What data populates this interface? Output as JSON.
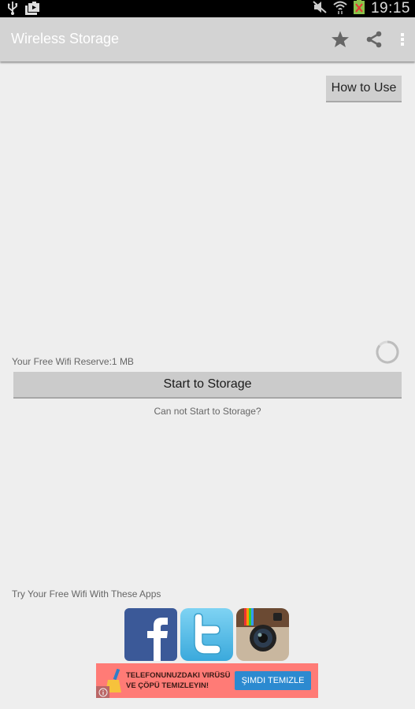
{
  "status_bar": {
    "time": "19:15",
    "left_icons": [
      "usb-icon",
      "screenshot-icon"
    ],
    "right_icons": [
      "mute-icon",
      "wifi-icon",
      "battery-icon"
    ]
  },
  "action_bar": {
    "title": "Wireless Storage",
    "actions": [
      {
        "name": "favorite",
        "icon": "star-icon"
      },
      {
        "name": "share",
        "icon": "share-icon"
      },
      {
        "name": "overflow-menu",
        "icon": "more-vert-icon"
      }
    ]
  },
  "main": {
    "how_to_use_label": "How to Use",
    "reserve_text": "Your Free Wifi Reserve:1 MB",
    "start_button_label": "Start to Storage",
    "cannot_start_link": "Can not Start to Storage?",
    "try_apps_text": "Try Your Free Wifi With These Apps",
    "apps": [
      {
        "name": "Facebook",
        "icon": "facebook-icon"
      },
      {
        "name": "Twitter",
        "icon": "twitter-icon"
      },
      {
        "name": "Instagram",
        "icon": "instagram-icon"
      }
    ]
  },
  "ad": {
    "line1": "TELEFONUNUZDAKI VIRÜSÜ",
    "line2": "VE ÇÖPÜ TEMIZLEYIN!",
    "cta": "ŞIMDI TEMIZLE",
    "info_glyph": "i",
    "colors": {
      "background": "#ff7b76",
      "cta": "#2c8ad0"
    }
  },
  "colors": {
    "status_bar": "#000000",
    "action_bar": "#d3d3d3",
    "background": "#eeeeee",
    "button": "#cbcbcb"
  }
}
